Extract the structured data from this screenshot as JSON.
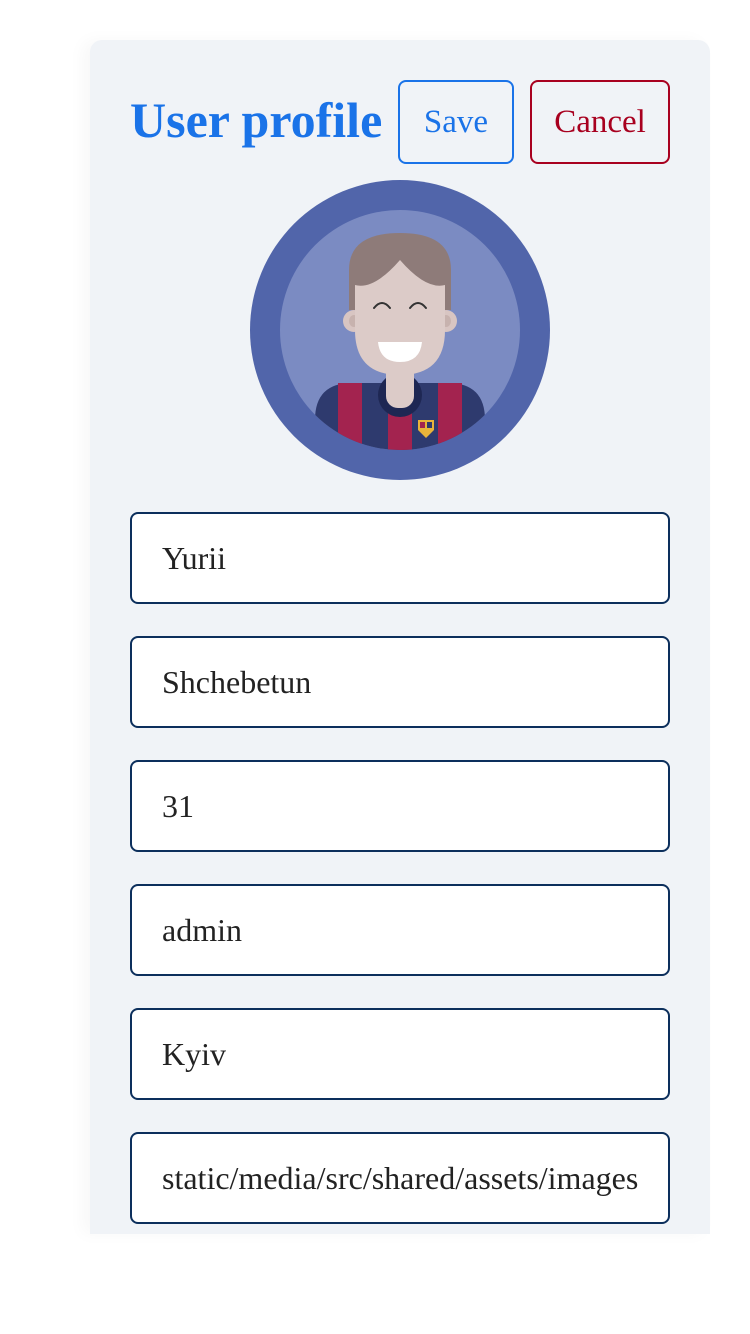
{
  "header": {
    "title": "User profile",
    "save_label": "Save",
    "cancel_label": "Cancel"
  },
  "avatar": {
    "icon": "cartoon-boy-avatar-icon",
    "outer_color": "#5165aa",
    "inner_color": "#7b8bc2"
  },
  "fields": {
    "first_name": "Yurii",
    "last_name": "Shchebetun",
    "age": "31",
    "role": "admin",
    "city": "Kyiv",
    "avatar_path": "static/media/src/shared/assets/images"
  },
  "colors": {
    "accent": "#1a73e8",
    "danger": "#a8001f",
    "field_border": "#0c2f5c",
    "card_bg": "#f0f3f7"
  }
}
